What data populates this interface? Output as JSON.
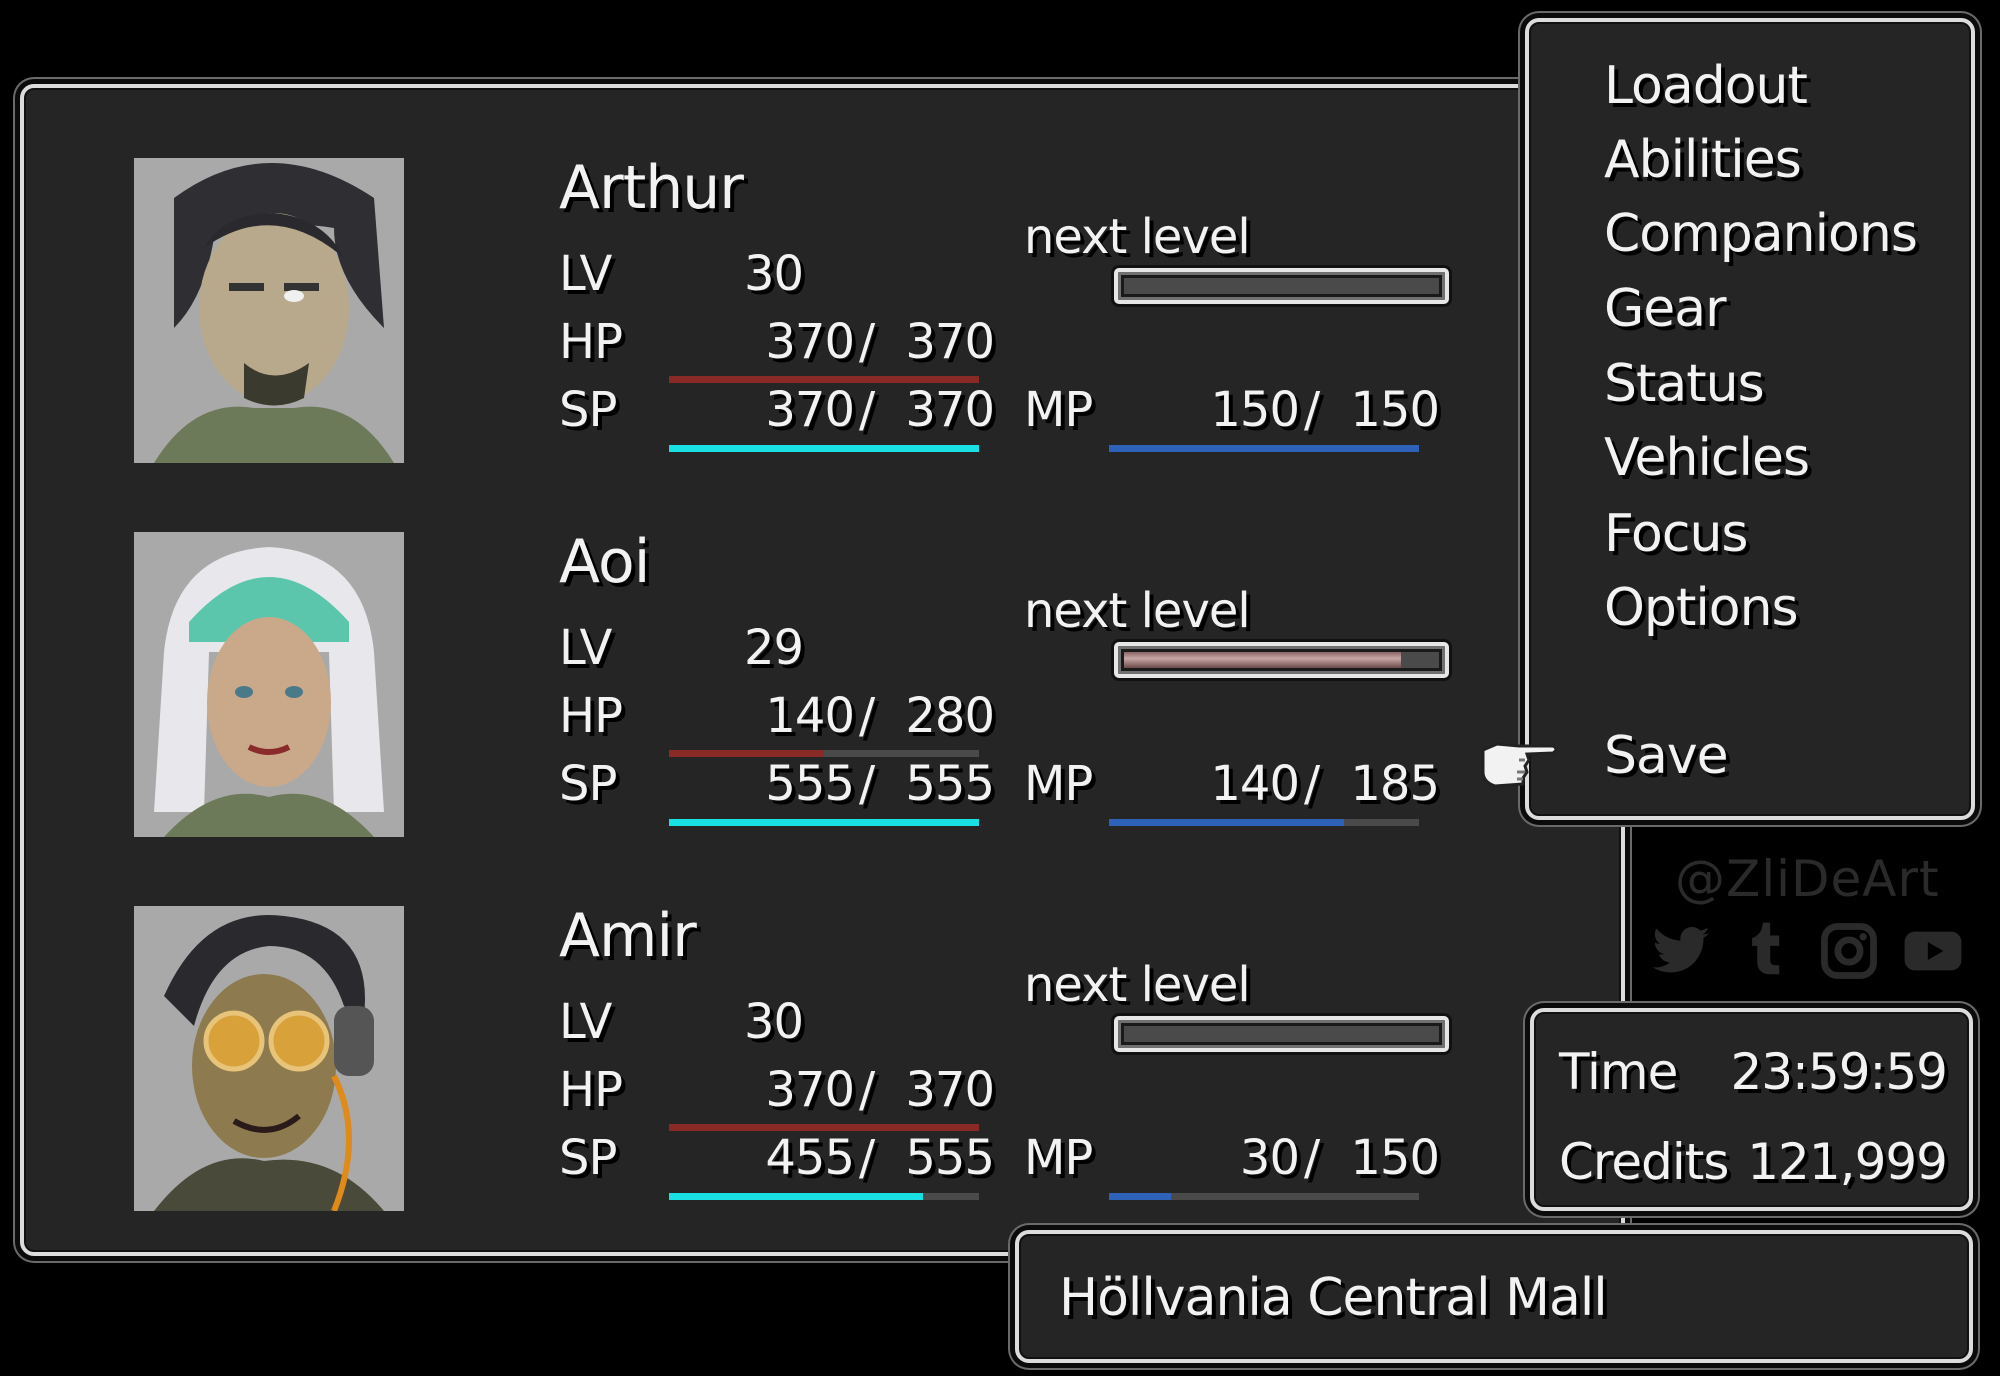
{
  "party": [
    {
      "name": "Arthur",
      "lv_label": "LV",
      "lv": "30",
      "hp_label": "HP",
      "hp_cur": "370",
      "hp_max": "370",
      "hp_ratio": 1.0,
      "sp_label": "SP",
      "sp_cur": "370",
      "sp_max": "370",
      "sp_ratio": 1.0,
      "mp_label": "MP",
      "mp_cur": "150",
      "mp_max": "150",
      "mp_ratio": 1.0,
      "next_label": "next level",
      "next_ratio": 0.0
    },
    {
      "name": "Aoi",
      "lv_label": "LV",
      "lv": "29",
      "hp_label": "HP",
      "hp_cur": "140",
      "hp_max": "280",
      "hp_ratio": 0.5,
      "sp_label": "SP",
      "sp_cur": "555",
      "sp_max": "555",
      "sp_ratio": 1.0,
      "mp_label": "MP",
      "mp_cur": "140",
      "mp_max": "185",
      "mp_ratio": 0.757,
      "next_label": "next level",
      "next_ratio": 0.88
    },
    {
      "name": "Amir",
      "lv_label": "LV",
      "lv": "30",
      "hp_label": "HP",
      "hp_cur": "370",
      "hp_max": "370",
      "hp_ratio": 1.0,
      "sp_label": "SP",
      "sp_cur": "455",
      "sp_max": "555",
      "sp_ratio": 0.82,
      "mp_label": "MP",
      "mp_cur": "30",
      "mp_max": "150",
      "mp_ratio": 0.2,
      "next_label": "next level",
      "next_ratio": 0.0
    }
  ],
  "menu": {
    "items": [
      "Loadout",
      "Abilities",
      "Companions",
      "Gear",
      "Status",
      "Vehicles",
      "Focus",
      "Options"
    ],
    "selected": "Save",
    "cursor_icon": "pointing-hand-icon"
  },
  "watermark": {
    "handle": "@ZliDeArt",
    "icons": [
      "twitter-icon",
      "tumblr-icon",
      "instagram-icon",
      "youtube-icon"
    ]
  },
  "stats": {
    "time_label": "Time",
    "time_value": "23:59:59",
    "credits_label": "Credits",
    "credits_value": "121,999"
  },
  "location": "Höllvania Central Mall",
  "colors": {
    "hp": "#8a2a26",
    "sp": "#19e0e3",
    "mp": "#2e62b8",
    "bar_empty": "#4a4a4a",
    "window_bg": "#252525",
    "window_border": "#dcdcdc",
    "text": "#f2f2f2"
  },
  "slash": "/"
}
